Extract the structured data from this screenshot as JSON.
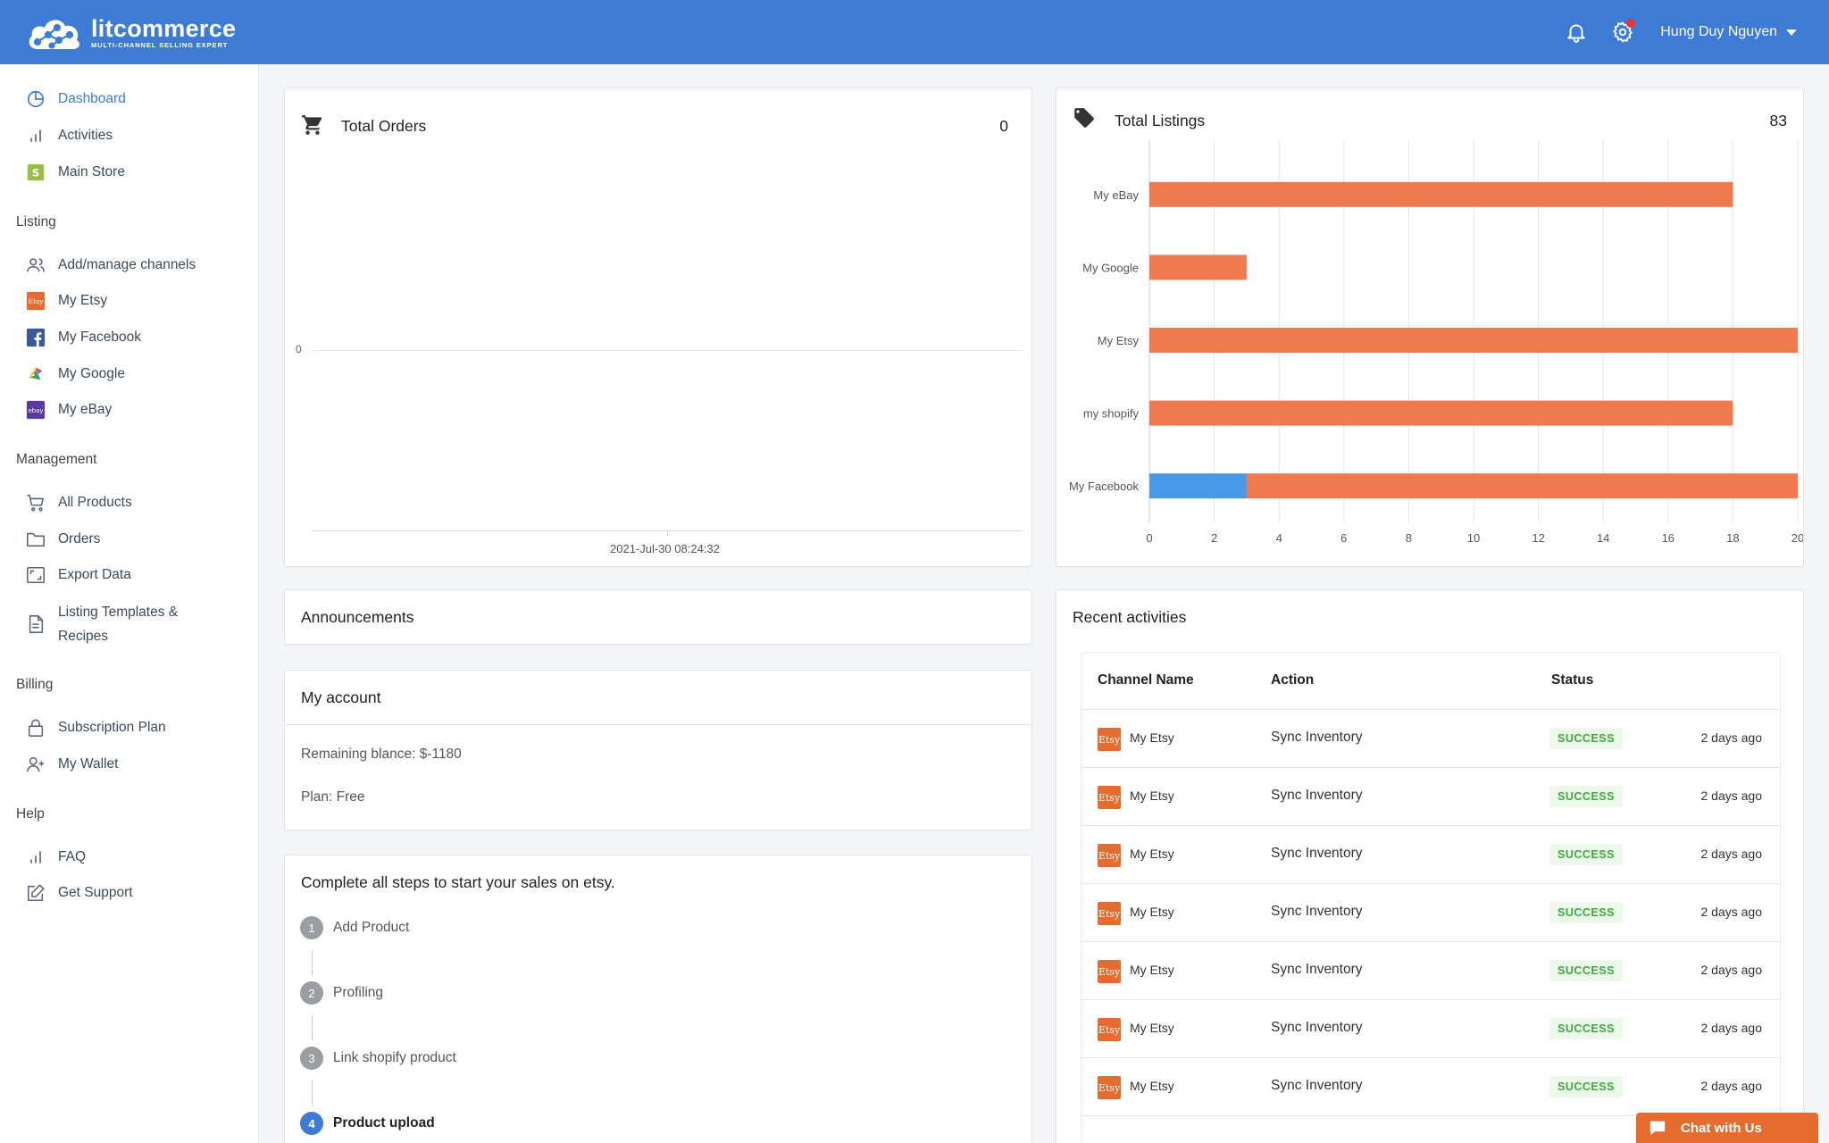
{
  "header": {
    "brand_name": "litcommerce",
    "brand_tagline": "MULTI-CHANNEL SELLING EXPERT",
    "user_name": "Hung Duy Nguyen",
    "bg_color": "#3d7bd5"
  },
  "sidebar": {
    "main": [
      {
        "label": "Dashboard",
        "icon": "pie-chart-icon",
        "active": true
      },
      {
        "label": "Activities",
        "icon": "bar-chart-icon"
      },
      {
        "label": "Main Store",
        "icon": "shopify-icon"
      }
    ],
    "listing_title": "Listing",
    "listing": [
      {
        "label": "Add/manage channels",
        "icon": "users-icon"
      },
      {
        "label": "My Etsy",
        "icon": "etsy-icon"
      },
      {
        "label": "My Facebook",
        "icon": "facebook-icon"
      },
      {
        "label": "My Google",
        "icon": "google-icon"
      },
      {
        "label": "My eBay",
        "icon": "ebay-icon"
      }
    ],
    "management_title": "Management",
    "management": [
      {
        "label": "All Products",
        "icon": "cart-icon"
      },
      {
        "label": "Orders",
        "icon": "folder-icon"
      },
      {
        "label": "Export Data",
        "icon": "export-icon"
      },
      {
        "label": "Listing Templates & Recipes",
        "icon": "document-icon"
      }
    ],
    "billing_title": "Billing",
    "billing": [
      {
        "label": "Subscription Plan",
        "icon": "lock-icon"
      },
      {
        "label": "My Wallet",
        "icon": "user-plus-icon"
      }
    ],
    "help_title": "Help",
    "help": [
      {
        "label": "FAQ",
        "icon": "bar-chart-icon"
      },
      {
        "label": "Get Support",
        "icon": "edit-icon"
      }
    ]
  },
  "total_orders": {
    "title": "Total Orders",
    "count": "0",
    "y_tick": "0",
    "x_label": "2021-Jul-30 08:24:32"
  },
  "chart_data": {
    "type": "bar",
    "orientation": "horizontal",
    "stacked": true,
    "title": "Total Listings",
    "total": 83,
    "categories": [
      "My eBay",
      "My Google",
      "My Etsy",
      "my shopify",
      "My Facebook"
    ],
    "series": [
      {
        "color": "#4a98e8",
        "values": [
          0,
          0,
          0,
          0,
          3
        ]
      },
      {
        "color": "#f07a4f",
        "values": [
          18,
          3,
          20,
          18,
          17
        ]
      }
    ],
    "xticks": [
      0,
      2,
      4,
      6,
      8,
      10,
      12,
      14,
      16,
      18,
      20
    ],
    "xlim": [
      0,
      20
    ],
    "grid": true,
    "legend": "none"
  },
  "announcements": {
    "title": "Announcements"
  },
  "account": {
    "title": "My account",
    "balance": "Remaining blance: $-1180",
    "plan": "Plan: Free"
  },
  "steps": {
    "title": "Complete all steps to start your sales on etsy.",
    "items": [
      {
        "num": "1",
        "label": "Add Product"
      },
      {
        "num": "2",
        "label": "Profiling"
      },
      {
        "num": "3",
        "label": "Link shopify product"
      },
      {
        "num": "4",
        "label": "Product upload",
        "active": true
      }
    ]
  },
  "activities": {
    "title": "Recent activities",
    "columns": [
      "Channel Name",
      "Action",
      "Status"
    ],
    "rows": [
      {
        "channel": "My Etsy",
        "logo": "Etsy",
        "action": "Sync Inventory",
        "status": "SUCCESS",
        "time": "2 days ago"
      },
      {
        "channel": "My Etsy",
        "logo": "Etsy",
        "action": "Sync Inventory",
        "status": "SUCCESS",
        "time": "2 days ago"
      },
      {
        "channel": "My Etsy",
        "logo": "Etsy",
        "action": "Sync Inventory",
        "status": "SUCCESS",
        "time": "2 days ago"
      },
      {
        "channel": "My Etsy",
        "logo": "Etsy",
        "action": "Sync Inventory",
        "status": "SUCCESS",
        "time": "2 days ago"
      },
      {
        "channel": "My Etsy",
        "logo": "Etsy",
        "action": "Sync Inventory",
        "status": "SUCCESS",
        "time": "2 days ago"
      },
      {
        "channel": "My Etsy",
        "logo": "Etsy",
        "action": "Sync Inventory",
        "status": "SUCCESS",
        "time": "2 days ago"
      },
      {
        "channel": "My Etsy",
        "logo": "Etsy",
        "action": "Sync Inventory",
        "status": "SUCCESS",
        "time": "2 days ago"
      }
    ]
  },
  "chat": {
    "label": "Chat with Us"
  }
}
